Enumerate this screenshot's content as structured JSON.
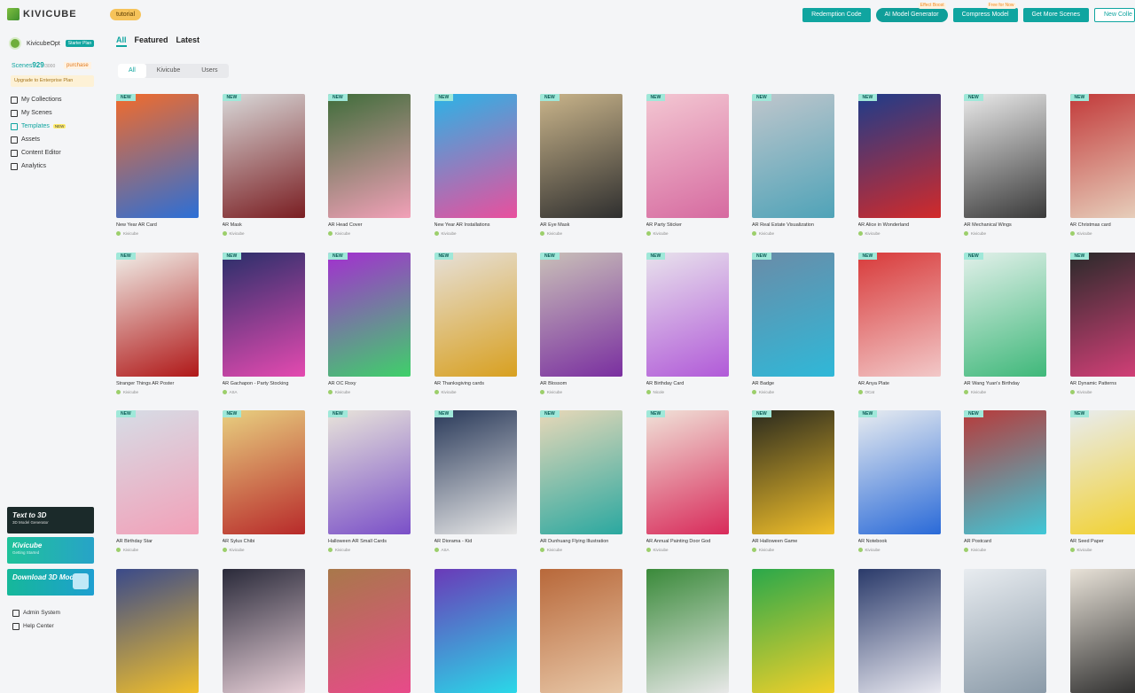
{
  "app": {
    "logo": "KIVICUBE",
    "tutorial": "tutorial"
  },
  "top_actions": [
    {
      "label": "Redemption Code",
      "flag": ""
    },
    {
      "label": "AI Model Generator",
      "flag": "Effect Boost"
    },
    {
      "label": "Compress Model",
      "flag": "Free for Now"
    },
    {
      "label": "Get More Scenes",
      "flag": ""
    },
    {
      "label": "New Colle",
      "flag": ""
    }
  ],
  "user": {
    "name": "KivicubeOpt",
    "plan": "Starter Plan",
    "scenes_label": "Scenes",
    "scenes_used": "929",
    "scenes_total": "/3000",
    "purchase": "purchase",
    "upgrade": "Upgrade to Enterprise Plan"
  },
  "nav": [
    {
      "label": "My Collections",
      "icon": "collection-icon",
      "badge": ""
    },
    {
      "label": "My Scenes",
      "icon": "scene-icon",
      "badge": ""
    },
    {
      "label": "Templates",
      "icon": "template-icon",
      "badge": "NEW"
    },
    {
      "label": "Assets",
      "icon": "asset-icon",
      "badge": ""
    },
    {
      "label": "Content Editor",
      "icon": "editor-icon",
      "badge": ""
    },
    {
      "label": "Analytics",
      "icon": "analytics-icon",
      "badge": ""
    }
  ],
  "promos": [
    {
      "title": "Text to 3D",
      "subtitle": "3D Model Generator"
    },
    {
      "title": "Kivicube",
      "subtitle": "Getting Started"
    },
    {
      "title": "Download 3D Models",
      "subtitle": ""
    }
  ],
  "bottom_nav": [
    {
      "label": "Admin System",
      "icon": "admin-icon"
    },
    {
      "label": "Help Center",
      "icon": "help-icon"
    }
  ],
  "main_tabs": [
    "All",
    "Featured",
    "Latest"
  ],
  "sub_tabs": [
    "All",
    "Kivicube",
    "Users"
  ],
  "cards": [
    {
      "title": "New Year AR Card",
      "author": "Kivicube",
      "tag": "NEW",
      "c1": "#f26b2b",
      "c2": "#2c6fd6"
    },
    {
      "title": "AR Mask",
      "author": "Kivicube",
      "tag": "NEW",
      "c1": "#d8d8d8",
      "c2": "#7a1e22"
    },
    {
      "title": "AR Head Cover",
      "author": "Kivicube",
      "tag": "NEW",
      "c1": "#3f6d3a",
      "c2": "#f2a0b8"
    },
    {
      "title": "New Year AR Installations",
      "author": "Kivicube",
      "tag": "NEW",
      "c1": "#2bb3e6",
      "c2": "#e94f9d"
    },
    {
      "title": "AR Eye Mask",
      "author": "Kivicube",
      "tag": "NEW",
      "c1": "#c9b48a",
      "c2": "#2f2f2f"
    },
    {
      "title": "AR Party Sticker",
      "author": "Kivicube",
      "tag": "NEW",
      "c1": "#f3c7d2",
      "c2": "#d66aa0"
    },
    {
      "title": "AR Real Estate Visualization",
      "author": "Kivicube",
      "tag": "NEW",
      "c1": "#bfc6cc",
      "c2": "#4fa3b8"
    },
    {
      "title": "AR Alice in Wonderland",
      "author": "Kivicube",
      "tag": "NEW",
      "c1": "#1e3c8a",
      "c2": "#d22a2a"
    },
    {
      "title": "AR Mechanical Wings",
      "author": "Kivicube",
      "tag": "NEW",
      "c1": "#e9e9e9",
      "c2": "#3a3a3a"
    },
    {
      "title": "AR Christmas card",
      "author": "Kivicube",
      "tag": "NEW",
      "c1": "#c23a3a",
      "c2": "#e8d4c0"
    },
    {
      "title": "Stranger Things AR Poster",
      "author": "Kivicube",
      "tag": "NEW",
      "c1": "#f0eee8",
      "c2": "#b01818"
    },
    {
      "title": "AR Gachapon - Party Stocking",
      "author": "ASA",
      "tag": "NEW",
      "c1": "#2a2f6a",
      "c2": "#e44ab0"
    },
    {
      "title": "AR OC Roxy",
      "author": "Kivicube",
      "tag": "NEW",
      "c1": "#a32fd0",
      "c2": "#3fd06a"
    },
    {
      "title": "AR Thanksgiving cards",
      "author": "Kivicube",
      "tag": "NEW",
      "c1": "#e6e0d8",
      "c2": "#d8a020"
    },
    {
      "title": "AR Blossom",
      "author": "Kivicube",
      "tag": "NEW",
      "c1": "#c9c0b8",
      "c2": "#7a2fa0"
    },
    {
      "title": "AR Birthday Card",
      "author": "Nicole",
      "tag": "NEW",
      "c1": "#e8e2ec",
      "c2": "#b15ad8"
    },
    {
      "title": "AR Badge",
      "author": "Kivicube",
      "tag": "NEW",
      "c1": "#6a8ca8",
      "c2": "#2fb8d8"
    },
    {
      "title": "AR Anya Plate",
      "author": "OCat",
      "tag": "NEW",
      "c1": "#d83a3a",
      "c2": "#f2c8c8"
    },
    {
      "title": "AR Wang Yuan's Birthday",
      "author": "Kivicube",
      "tag": "NEW",
      "c1": "#e2f0ea",
      "c2": "#3fb87a"
    },
    {
      "title": "AR Dynamic Patterns",
      "author": "Kivicube",
      "tag": "NEW",
      "c1": "#2a2a2a",
      "c2": "#d8407a"
    },
    {
      "title": "AR Birthday Star",
      "author": "Kivicube",
      "tag": "NEW",
      "c1": "#d6dde6",
      "c2": "#f2a0b8"
    },
    {
      "title": "AR Sylus Chibi",
      "author": "Kivicube",
      "tag": "NEW",
      "c1": "#e8d080",
      "c2": "#b82a2a"
    },
    {
      "title": "Halloween AR Small Cards",
      "author": "Kivicube",
      "tag": "NEW",
      "c1": "#e8e4da",
      "c2": "#7a4fc8"
    },
    {
      "title": "AR Diorama - Kid",
      "author": "ASA",
      "tag": "NEW",
      "c1": "#2a3a5a",
      "c2": "#e8e8e8"
    },
    {
      "title": "AR Dunhuang Flying Illustration",
      "author": "Kivicube",
      "tag": "NEW",
      "c1": "#e8d8b8",
      "c2": "#2aa8a0"
    },
    {
      "title": "AR Annual Painting Door God",
      "author": "Kivicube",
      "tag": "NEW",
      "c1": "#f0e2d8",
      "c2": "#d82a5a"
    },
    {
      "title": "AR Halloween Game",
      "author": "Kivicube",
      "tag": "NEW",
      "c1": "#2a2a1e",
      "c2": "#f2c02a"
    },
    {
      "title": "AR Notebook",
      "author": "Kivicube",
      "tag": "NEW",
      "c1": "#e8ecf0",
      "c2": "#2a6ad8"
    },
    {
      "title": "AR Postcard",
      "author": "Kivicube",
      "tag": "NEW",
      "c1": "#b83a3a",
      "c2": "#3fc8d8"
    },
    {
      "title": "AR Seed Paper",
      "author": "Kivicube",
      "tag": "NEW",
      "c1": "#e8ecf0",
      "c2": "#f2d02a"
    },
    {
      "title": "",
      "author": "",
      "tag": "",
      "c1": "#3a4a8a",
      "c2": "#f2c02a"
    },
    {
      "title": "",
      "author": "",
      "tag": "",
      "c1": "#2a2a3a",
      "c2": "#e8d0d8"
    },
    {
      "title": "",
      "author": "",
      "tag": "",
      "c1": "#a8784a",
      "c2": "#e84a8a"
    },
    {
      "title": "",
      "author": "",
      "tag": "",
      "c1": "#6a3ab8",
      "c2": "#2ad8e8"
    },
    {
      "title": "",
      "author": "",
      "tag": "",
      "c1": "#b8683a",
      "c2": "#e8c8a8"
    },
    {
      "title": "",
      "author": "",
      "tag": "",
      "c1": "#3a8a3a",
      "c2": "#e8e8e8"
    },
    {
      "title": "",
      "author": "",
      "tag": "",
      "c1": "#2aa84a",
      "c2": "#f2d02a"
    },
    {
      "title": "",
      "author": "",
      "tag": "",
      "c1": "#2a3a6a",
      "c2": "#e8e8f0"
    },
    {
      "title": "",
      "author": "",
      "tag": "",
      "c1": "#e8ecf0",
      "c2": "#8a9aa8"
    },
    {
      "title": "",
      "author": "",
      "tag": "",
      "c1": "#e8e2d8",
      "c2": "#2a2a2a"
    }
  ]
}
